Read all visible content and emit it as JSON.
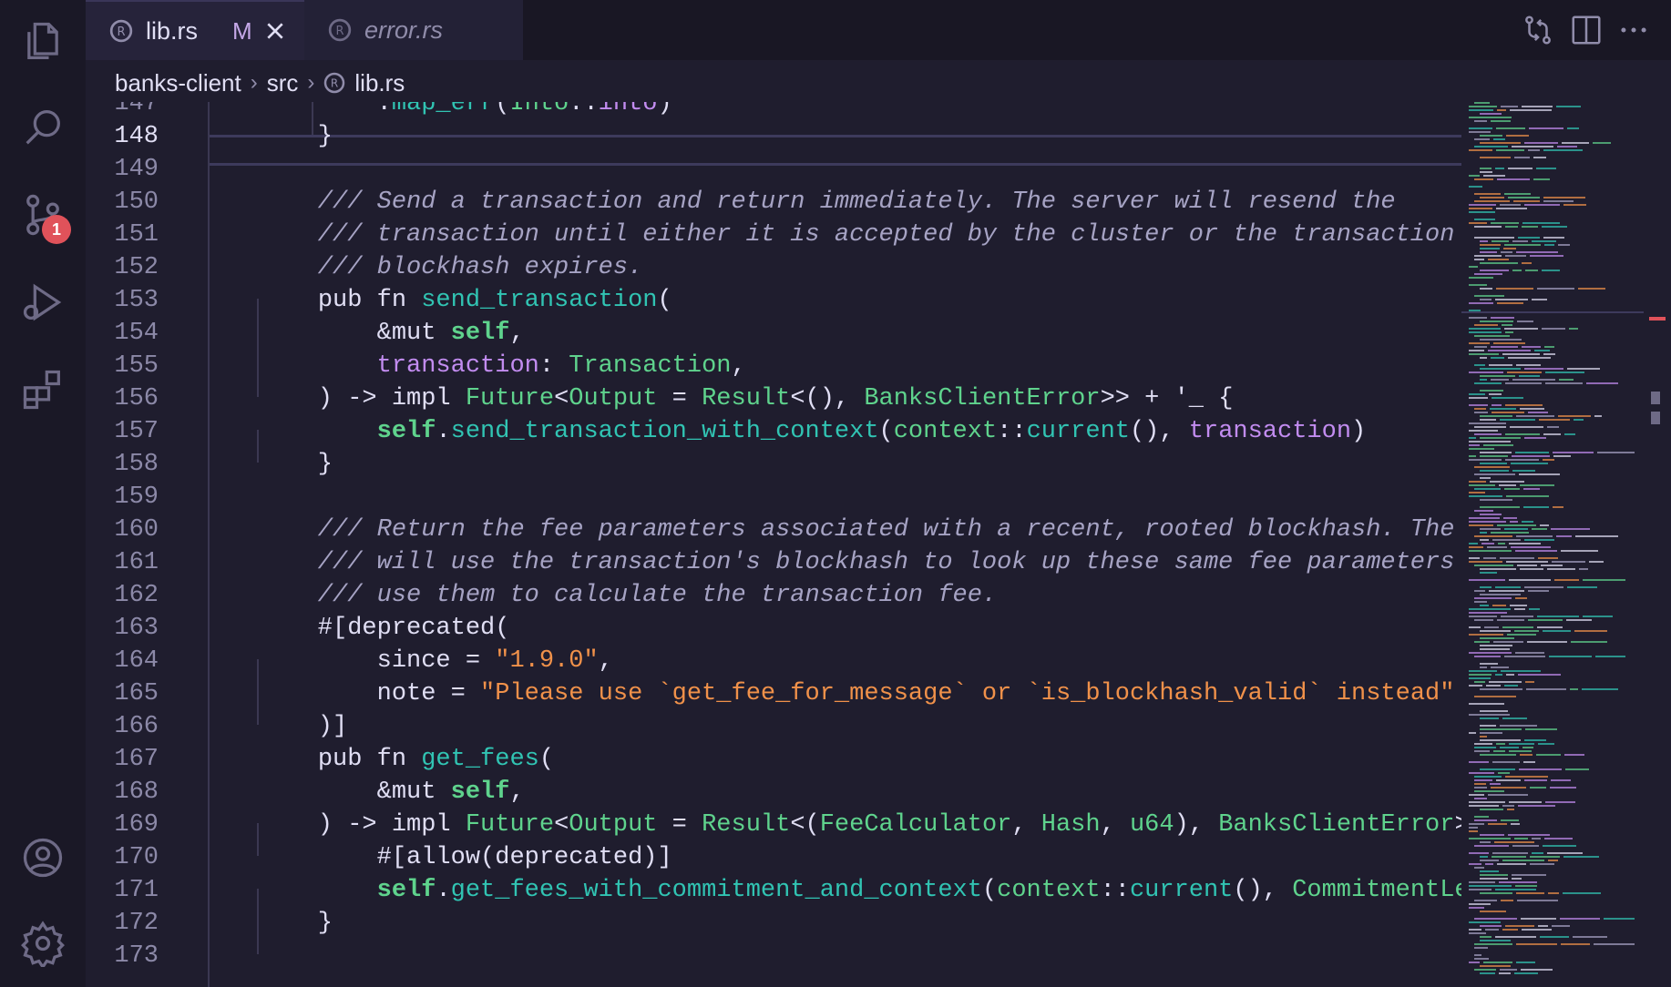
{
  "activity_bar": {
    "items": [
      "explorer",
      "search",
      "source-control",
      "run-and-debug",
      "extensions"
    ],
    "source_control_badge": "1",
    "bottom": [
      "accounts",
      "manage"
    ]
  },
  "tabs": [
    {
      "label": "lib.rs",
      "status": "M",
      "active": true
    },
    {
      "label": "error.rs",
      "active": false
    }
  ],
  "breadcrumb": [
    "banks-client",
    "src",
    "lib.rs"
  ],
  "editor": {
    "current_line": "148",
    "lines": [
      {
        "n": "147",
        "code": "        .map_err(Into::into)"
      },
      {
        "n": "148",
        "code": "    }"
      },
      {
        "n": "149",
        "code": ""
      },
      {
        "n": "150",
        "code": "    /// Send a transaction and return immediately. The server will resend the"
      },
      {
        "n": "151",
        "code": "    /// transaction until either it is accepted by the cluster or the transaction's"
      },
      {
        "n": "152",
        "code": "    /// blockhash expires."
      },
      {
        "n": "153",
        "code": "    pub fn send_transaction("
      },
      {
        "n": "154",
        "code": "        &mut self,"
      },
      {
        "n": "155",
        "code": "        transaction: Transaction,"
      },
      {
        "n": "156",
        "code": "    ) -> impl Future<Output = Result<(), BanksClientError>> + '_ {"
      },
      {
        "n": "157",
        "code": "        self.send_transaction_with_context(context::current(), transaction)"
      },
      {
        "n": "158",
        "code": "    }"
      },
      {
        "n": "159",
        "code": ""
      },
      {
        "n": "160",
        "code": "    /// Return the fee parameters associated with a recent, rooted blockhash. The cluster"
      },
      {
        "n": "161",
        "code": "    /// will use the transaction's blockhash to look up these same fee parameters and"
      },
      {
        "n": "162",
        "code": "    /// use them to calculate the transaction fee."
      },
      {
        "n": "163",
        "code": "    #[deprecated("
      },
      {
        "n": "164",
        "code": "        since = \"1.9.0\","
      },
      {
        "n": "165",
        "code": "        note = \"Please use `get_fee_for_message` or `is_blockhash_valid` instead\""
      },
      {
        "n": "166",
        "code": "    )]"
      },
      {
        "n": "167",
        "code": "    pub fn get_fees("
      },
      {
        "n": "168",
        "code": "        &mut self,"
      },
      {
        "n": "169",
        "code": "    ) -> impl Future<Output = Result<(FeeCalculator, Hash, u64), BanksClientError>> + '_ {"
      },
      {
        "n": "170",
        "code": "        #[allow(deprecated)]"
      },
      {
        "n": "171",
        "code": "        self.get_fees_with_commitment_and_context(context::current(), CommitmentLevel::default("
      },
      {
        "n": "172",
        "code": "    }"
      },
      {
        "n": "173",
        "code": ""
      }
    ]
  },
  "colors": {
    "background": "#1f1d2e",
    "activity_bar": "#1a1826",
    "function": "#31c4b3",
    "type": "#5fd38d",
    "parameter": "#c28cf0",
    "string": "#f0914a",
    "comment": "#a6a3c4",
    "badge": "#e0525a"
  }
}
